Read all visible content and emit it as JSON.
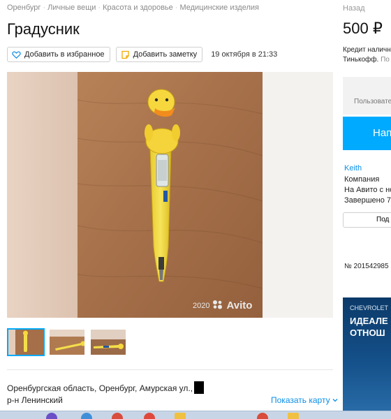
{
  "breadcrumbs": [
    "Оренбург",
    "Личные вещи",
    "Красота и здоровье",
    "Медицинские изделия"
  ],
  "title": "Градусник",
  "actions": {
    "favorite_label": "Добавить в избранное",
    "note_label": "Добавить заметку",
    "date": "19 октября в 21:33"
  },
  "photo": {
    "watermark_year": "2020",
    "watermark_brand": "Avito"
  },
  "location": {
    "address": "Оренбургская область, Оренбург, Амурская ул.,",
    "district": "р-н Ленинский",
    "map_link": "Показать карту"
  },
  "sidebar": {
    "back": "Назад",
    "price": "500 ₽",
    "credit_line1": "Кредит наличн",
    "credit_line2": "Тинькофф.",
    "credit_more": "По",
    "user_hint": "Пользовате",
    "write_button": "Нап",
    "seller_name": "Keith",
    "seller_type": "Компания",
    "seller_since": "На Авито с но",
    "seller_done": "Завершено 7",
    "subscribe": "Под",
    "ad_number": "№ 201542985",
    "banner_brand": "CHEVROLET",
    "banner_line1": "ИДЕАЛЕ",
    "banner_line2": "ОТНОШ"
  },
  "colors": {
    "accent": "#00aaff",
    "link": "#0a8ee8"
  }
}
